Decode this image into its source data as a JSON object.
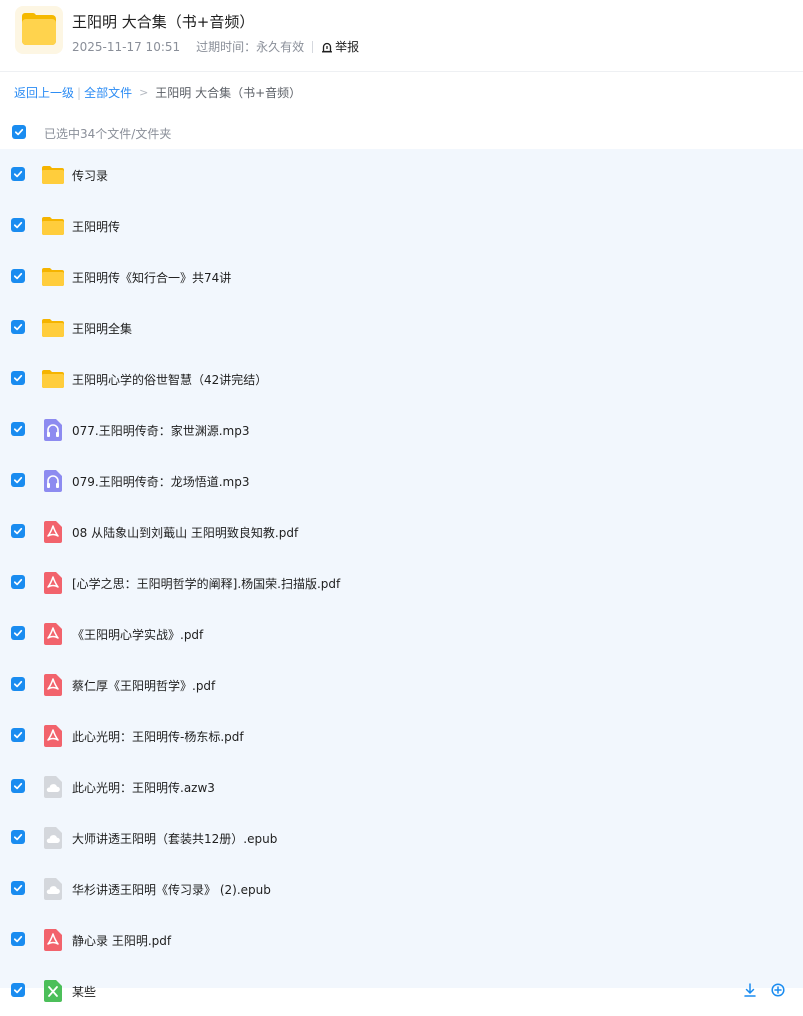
{
  "header": {
    "title": "王阳明 大合集（书+音频）",
    "date": "2025-11-17 10:51",
    "expire_label": "过期时间：",
    "expire_value": "永久有效",
    "report_label": "举报"
  },
  "breadcrumb": {
    "back": "返回上一级",
    "separator": "|",
    "all_files": "全部文件",
    "arrow": ">",
    "current": "王阳明 大合集（书+音频）"
  },
  "selection": {
    "label": "已选中34个文件/文件夹"
  },
  "colors": {
    "accent": "#1a8cf0",
    "folder": "#ffc928",
    "audio": "#8d8bf0",
    "pdf": "#f2636c",
    "unknown": "#d4d7dc",
    "excel": "#4cbf5a",
    "list_bg": "#f2f7fd"
  },
  "files": [
    {
      "name": "传习录",
      "type": "folder"
    },
    {
      "name": "王阳明传",
      "type": "folder"
    },
    {
      "name": "王阳明传《知行合一》共74讲",
      "type": "folder"
    },
    {
      "name": "王阳明全集",
      "type": "folder"
    },
    {
      "name": "王阳明心学的俗世智慧（42讲完结）",
      "type": "folder"
    },
    {
      "name": "077.王阳明传奇：家世渊源.mp3",
      "type": "audio"
    },
    {
      "name": "079.王阳明传奇：龙场悟道.mp3",
      "type": "audio"
    },
    {
      "name": "08 从陆象山到刘蕺山 王阳明致良知教.pdf",
      "type": "pdf"
    },
    {
      "name": "[心学之思：王阳明哲学的阐释].杨国荣.扫描版.pdf",
      "type": "pdf"
    },
    {
      "name": "《王阳明心学实战》.pdf",
      "type": "pdf"
    },
    {
      "name": "蔡仁厚《王阳明哲学》.pdf",
      "type": "pdf"
    },
    {
      "name": "此心光明：王阳明传-杨东标.pdf",
      "type": "pdf"
    },
    {
      "name": "此心光明：王阳明传.azw3",
      "type": "unknown"
    },
    {
      "name": "大师讲透王阳明（套装共12册）.epub",
      "type": "unknown"
    },
    {
      "name": "华杉讲透王阳明《传习录》 (2).epub",
      "type": "unknown"
    },
    {
      "name": "静心录 王阳明.pdf",
      "type": "pdf"
    },
    {
      "name": "某些",
      "type": "excel",
      "partial": true
    }
  ]
}
